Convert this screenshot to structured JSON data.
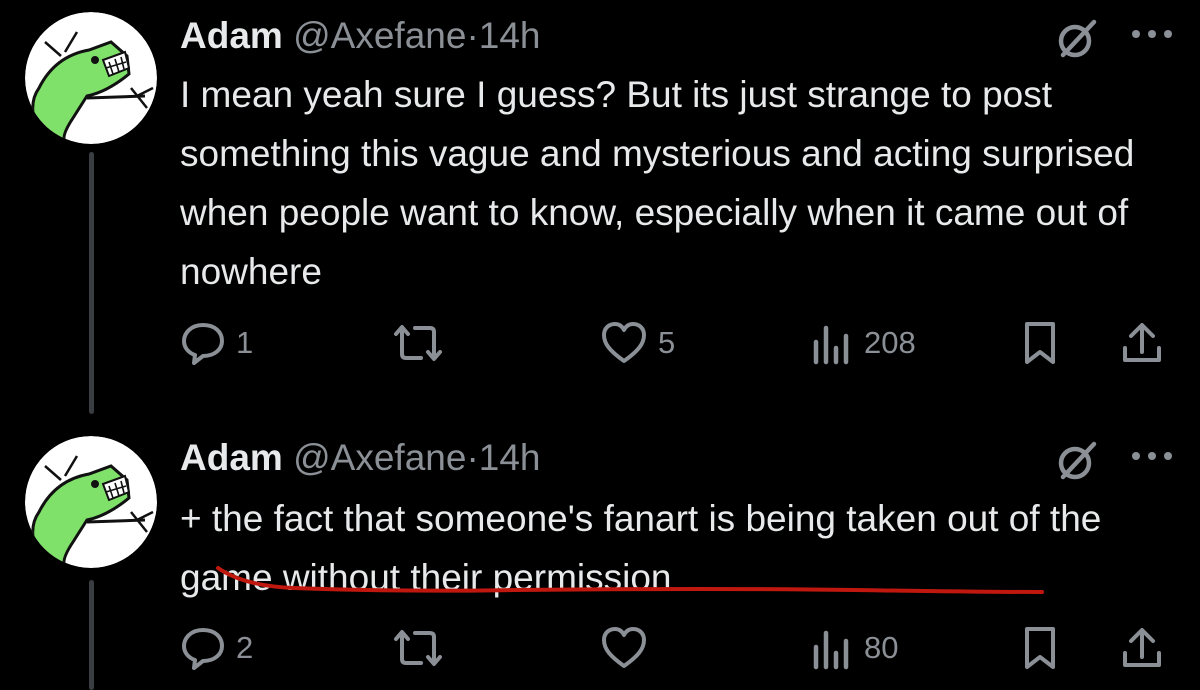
{
  "tweets": [
    {
      "author": {
        "name": "Adam",
        "handle": "@Axefane",
        "separator": "·",
        "time": "14h"
      },
      "text": "I mean yeah sure I guess? But its just strange to post something this vague and mysterious and acting surprised when people want to know, especially when it came out of nowhere",
      "metrics": {
        "replies": "1",
        "reposts": "",
        "likes": "5",
        "views": "208"
      }
    },
    {
      "author": {
        "name": "Adam",
        "handle": "@Axefane",
        "separator": "·",
        "time": "14h"
      },
      "text": "+ the fact that someone's fanart is being taken out of the game without their permission",
      "metrics": {
        "replies": "2",
        "reposts": "",
        "likes": "",
        "views": "80"
      }
    }
  ],
  "icons": {
    "reply": "speech-bubble-icon",
    "repost": "repost-arrows-icon",
    "like": "heart-icon",
    "views": "bar-chart-icon",
    "bookmark": "bookmark-icon",
    "share": "share-upload-icon",
    "grok": "slashed-circle-icon",
    "more": "ellipsis-icon"
  },
  "colors": {
    "background": "#000000",
    "text": "#e7e9ea",
    "secondary": "#8b9096",
    "avatar_green": "#7fe06a",
    "annotation_red": "#c0180f"
  }
}
